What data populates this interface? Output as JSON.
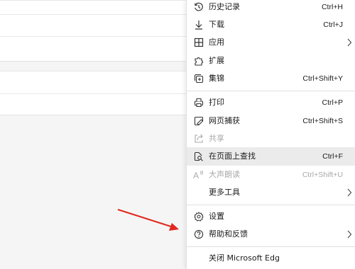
{
  "colors": {
    "menu_bg": "#ffffff",
    "highlight": "#ebebeb",
    "disabled": "#a8a8a8",
    "arrow": "#e0281e"
  },
  "menu": {
    "items": [
      {
        "label": "历史记录",
        "shortcut": "Ctrl+H",
        "icon": "history-icon"
      },
      {
        "label": "下载",
        "shortcut": "Ctrl+J",
        "icon": "download-icon"
      },
      {
        "label": "应用",
        "icon": "apps-icon",
        "submenu": true
      },
      {
        "label": "扩展",
        "icon": "extensions-icon"
      },
      {
        "label": "集锦",
        "shortcut": "Ctrl+Shift+Y",
        "icon": "collections-icon"
      },
      {
        "label": "打印",
        "shortcut": "Ctrl+P",
        "icon": "print-icon"
      },
      {
        "label": "网页捕获",
        "shortcut": "Ctrl+Shift+S",
        "icon": "web-capture-icon"
      },
      {
        "label": "共享",
        "icon": "share-icon",
        "disabled": true
      },
      {
        "label": "在页面上查找",
        "shortcut": "Ctrl+F",
        "icon": "find-on-page-icon",
        "highlighted": true
      },
      {
        "label": "大声朗读",
        "shortcut": "Ctrl+Shift+U",
        "icon": "read-aloud-icon",
        "disabled": true
      },
      {
        "label": "更多工具",
        "submenu": true
      },
      {
        "label": "设置",
        "icon": "settings-icon"
      },
      {
        "label": "帮助和反馈",
        "icon": "help-icon",
        "submenu": true
      },
      {
        "label": "关闭 Microsoft Edg"
      }
    ]
  }
}
